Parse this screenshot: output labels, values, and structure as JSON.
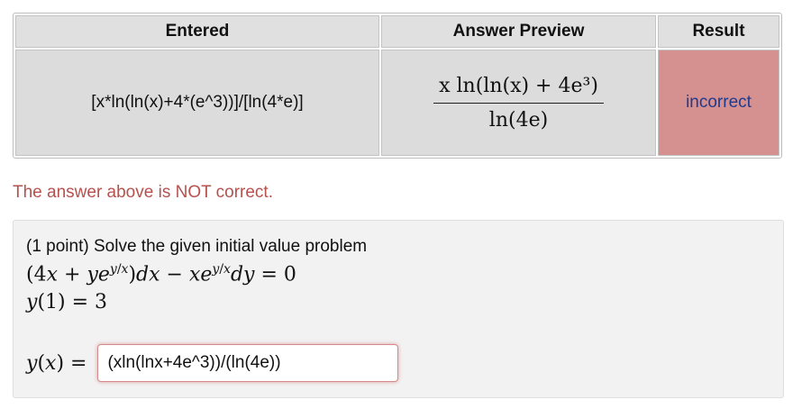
{
  "results_table": {
    "headers": [
      "Entered",
      "Answer Preview",
      "Result"
    ],
    "entered": "[x*ln(ln(x)+4*(e^3))]/[ln(4*e)]",
    "preview_numerator": "x ln(ln(x) + 4e³)",
    "preview_denominator": "ln(4e)",
    "result": "incorrect"
  },
  "status_message": "The answer above is NOT correct.",
  "problem": {
    "statement": "(1 point) Solve the given initial value problem",
    "equation": "(4x + ye^{y/x})dx − xe^{y/x}dy = 0",
    "initial_condition": "y(1) = 3",
    "answer_label": "y(x) =",
    "answer_value": "(xln(lnx+4e^3))/(ln(4e))"
  },
  "colors": {
    "incorrect_bg": "#d59090",
    "incorrect_text": "#1f3b8f",
    "status_text": "#b5524e"
  }
}
